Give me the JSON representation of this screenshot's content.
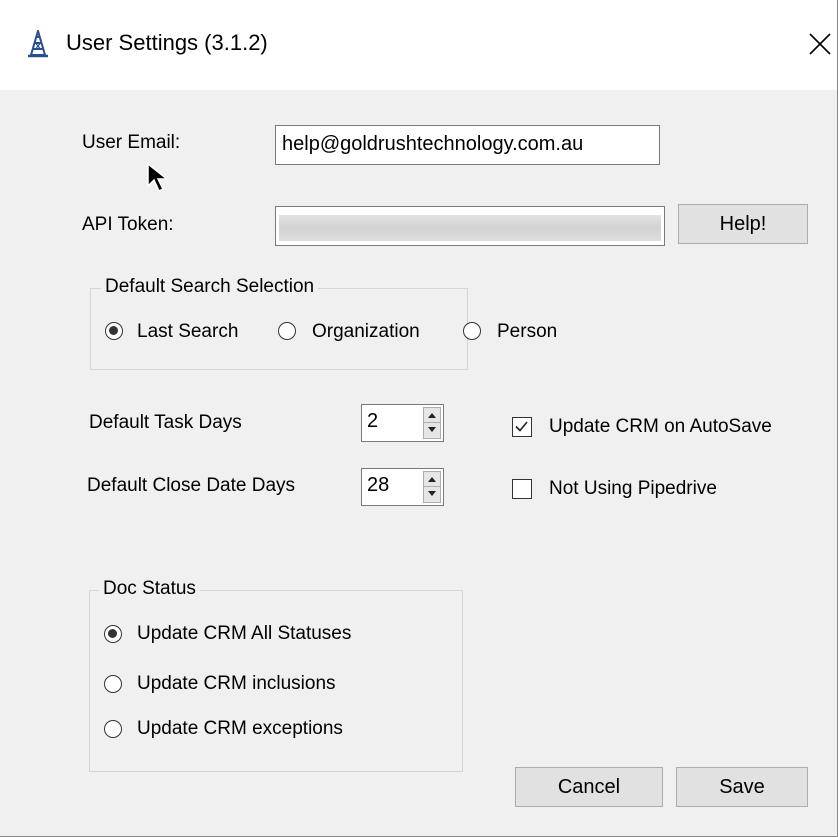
{
  "window": {
    "title": "User Settings (3.1.2)",
    "app_icon": "gold-rush-tower-icon",
    "close_icon": "close-icon"
  },
  "user_email": {
    "label": "User Email:",
    "value": "help@goldrushtechnology.com.au"
  },
  "api_token": {
    "label": "API Token:",
    "value": "",
    "help_button": "Help!"
  },
  "default_search": {
    "title": "Default Search Selection",
    "options": [
      {
        "label": "Last Search",
        "selected": true
      },
      {
        "label": "Organization",
        "selected": false
      },
      {
        "label": "Person",
        "selected": false
      }
    ]
  },
  "task_days": {
    "label": "Default Task Days",
    "value": "2"
  },
  "close_date_days": {
    "label": "Default Close Date Days",
    "value": "28"
  },
  "checkboxes": {
    "update_crm_autosave": {
      "label": "Update CRM on AutoSave",
      "checked": true
    },
    "not_using_pipedrive": {
      "label": "Not Using Pipedrive",
      "checked": false
    }
  },
  "doc_status": {
    "title": "Doc Status",
    "options": [
      {
        "label": "Update CRM All Statuses",
        "selected": true
      },
      {
        "label": "Update CRM inclusions",
        "selected": false
      },
      {
        "label": "Update CRM exceptions",
        "selected": false
      }
    ]
  },
  "buttons": {
    "cancel": "Cancel",
    "save": "Save"
  },
  "colors": {
    "dialog_bg": "#f0f0f0",
    "titlebar_bg": "#ffffff",
    "button_bg": "#e1e1e1"
  }
}
